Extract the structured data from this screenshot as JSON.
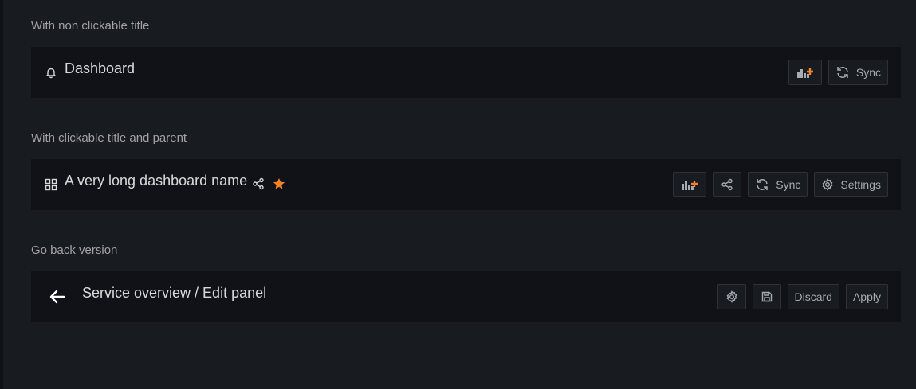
{
  "sections": [
    {
      "label": "With non clickable title",
      "title": "Dashboard",
      "title_icon": "bell-icon",
      "actions": [
        {
          "icon": "add-panel-icon",
          "label": ""
        },
        {
          "icon": "sync-icon",
          "label": "Sync"
        }
      ]
    },
    {
      "label": "With clickable title and parent",
      "title": "A very long dashboard name",
      "title_icon": "apps-grid-icon",
      "actions": [
        {
          "icon": "add-panel-icon",
          "label": ""
        },
        {
          "icon": "share-icon",
          "label": ""
        },
        {
          "icon": "sync-icon",
          "label": "Sync"
        },
        {
          "icon": "gear-icon",
          "label": "Settings"
        }
      ]
    },
    {
      "label": "Go back version",
      "title": "Service overview / Edit panel",
      "title_icon": "arrow-left-icon",
      "actions": [
        {
          "icon": "gear-icon",
          "label": ""
        },
        {
          "icon": "save-icon",
          "label": ""
        },
        {
          "icon": "",
          "label": "Discard"
        },
        {
          "icon": "",
          "label": "Apply"
        }
      ]
    }
  ],
  "colors": {
    "accent_orange": "#f4802a",
    "bar_background": "#111217",
    "page_background": "#181b1f"
  }
}
